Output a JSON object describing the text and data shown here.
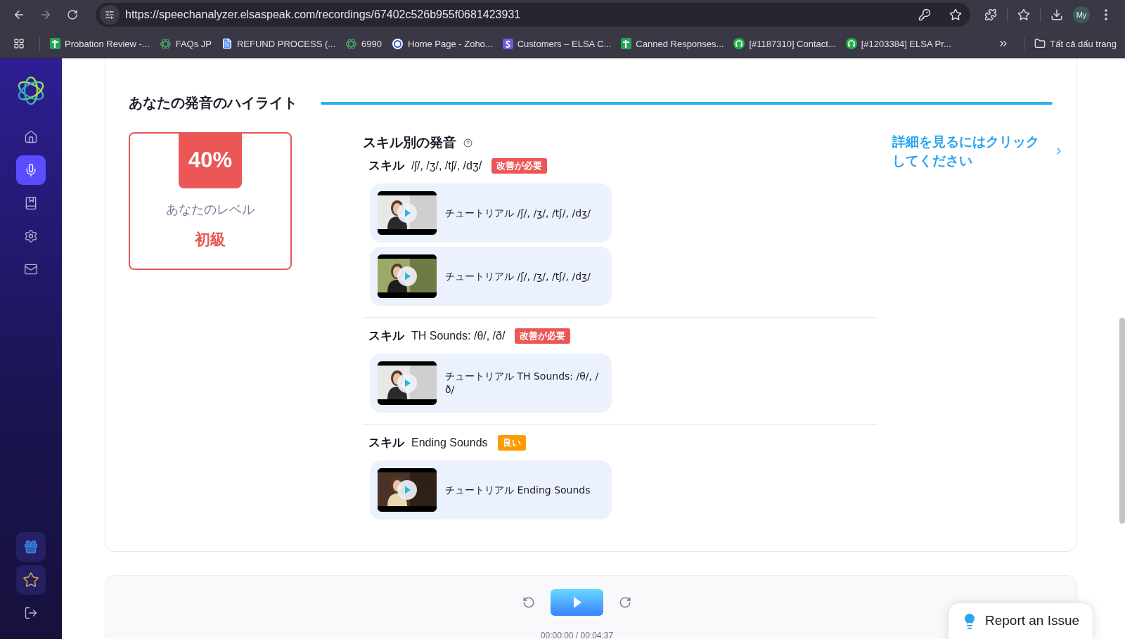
{
  "browser": {
    "url": "https://speechanalyzer.elsaspeak.com/recordings/67402c526b955f0681423931",
    "profile": "My",
    "bookmarks": [
      {
        "label": "Probation Review -...",
        "kind": "sheets"
      },
      {
        "label": "FAQs JP",
        "kind": "elsa"
      },
      {
        "label": "REFUND PROCESS (...",
        "kind": "docs"
      },
      {
        "label": "6990",
        "kind": "elsa"
      },
      {
        "label": "Home Page - Zoho...",
        "kind": "zoho"
      },
      {
        "label": "Customers – ELSA C...",
        "kind": "app"
      },
      {
        "label": "Canned Responses...",
        "kind": "sheets"
      },
      {
        "label": "[#1187310] Contact...",
        "kind": "headset"
      },
      {
        "label": "[#1203384] ELSA Pr...",
        "kind": "headset"
      }
    ],
    "all_bookmarks": "Tất cả dấu trang"
  },
  "sidebar": {
    "items": [
      {
        "kind": "home",
        "selected": false
      },
      {
        "kind": "mic",
        "selected": true
      },
      {
        "kind": "book",
        "selected": false
      },
      {
        "kind": "settings",
        "selected": false
      },
      {
        "kind": "mail",
        "selected": false
      }
    ],
    "bottom_items": [
      {
        "kind": "gift"
      },
      {
        "kind": "star"
      },
      {
        "kind": "logout"
      }
    ]
  },
  "highlight": {
    "title": "あなたの発音のハイライト",
    "level_card": {
      "percent": "40%",
      "label": "あなたのレベル",
      "level": "初級"
    },
    "skills": {
      "title": "スキル別の発音",
      "details_link": "詳細を見るにはクリックしてください",
      "groups": [
        {
          "prefix": "スキル",
          "name": "/ʃ/, /ʒ/, /tʃ/, /dʒ/",
          "badge": {
            "text": "改善が必要",
            "kind": "needs_improvement"
          },
          "tutorials": [
            {
              "title": "チュートリアル /ʃ/, /ʒ/, /tʃ/, /dʒ/"
            },
            {
              "title": "チュートリアル /ʃ/, /ʒ/, /tʃ/, /dʒ/"
            }
          ]
        },
        {
          "prefix": "スキル",
          "name": "TH Sounds: /θ/, /ð/",
          "badge": {
            "text": "改善が必要",
            "kind": "needs_improvement"
          },
          "tutorials": [
            {
              "title": "チュートリアル TH Sounds: /θ/, /ð/"
            }
          ]
        },
        {
          "prefix": "スキル",
          "name": "Ending Sounds",
          "badge": {
            "text": "良い",
            "kind": "good"
          },
          "tutorials": [
            {
              "title": "チュートリアル Ending Sounds"
            }
          ]
        }
      ]
    }
  },
  "player": {
    "time": "00:00:00 / 00:04:37"
  },
  "report_button": "Report an Issue"
}
